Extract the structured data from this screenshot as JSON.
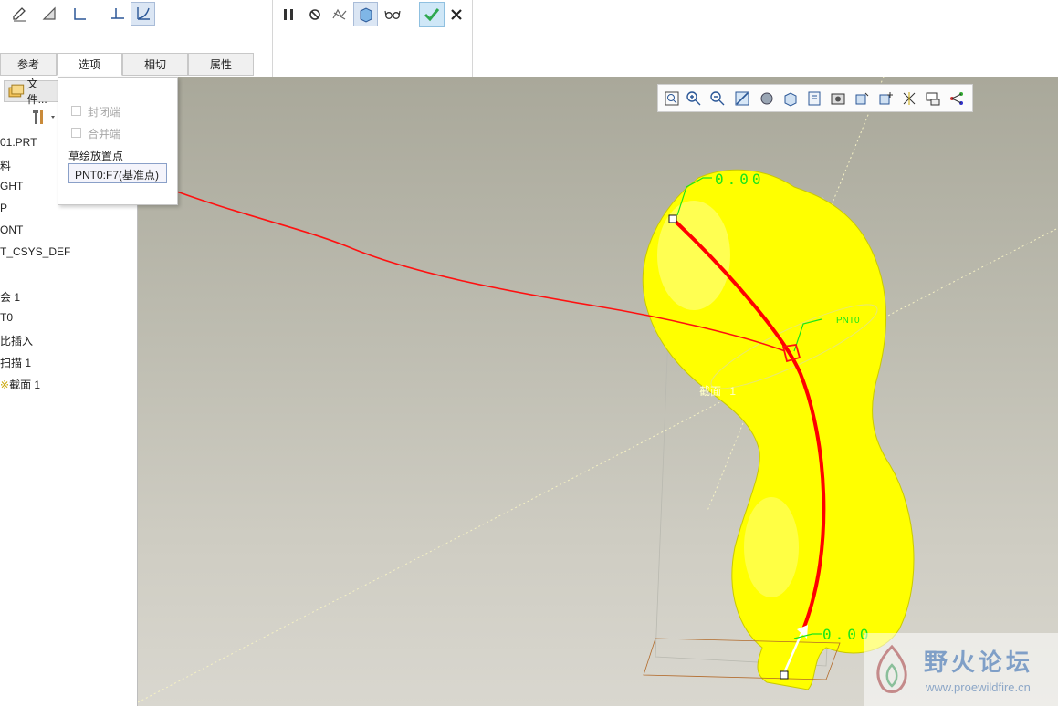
{
  "tabs": [
    {
      "label": "参考"
    },
    {
      "label": "选项"
    },
    {
      "label": "相切"
    },
    {
      "label": "属性"
    }
  ],
  "left_panel": {
    "file_button": "文件...",
    "tree": [
      "01.PRT",
      "料",
      "GHT",
      "P",
      "ONT",
      "T_CSYS_DEF",
      "会 1",
      "T0",
      "比插入",
      "扫描 1",
      "截面 1"
    ]
  },
  "options_panel": {
    "closed_ends_label": "封闭端",
    "merge_ends_label": "合并端",
    "sketch_point_label": "草绘放置点",
    "sketch_point_value": "PNT0:F7(基准点)"
  },
  "viewport": {
    "dim_top": "0.00",
    "dim_bottom": "0.00",
    "section_label": "截面",
    "section_value": "1",
    "point_label": "PNT0"
  },
  "watermark": {
    "title": "野火论坛",
    "url": "www.proewildfire.cn"
  },
  "colors": {
    "model": "#ffff00",
    "trajectory": "#ff0000",
    "confirm": "#6cc24a",
    "dimension": "#19e619"
  }
}
